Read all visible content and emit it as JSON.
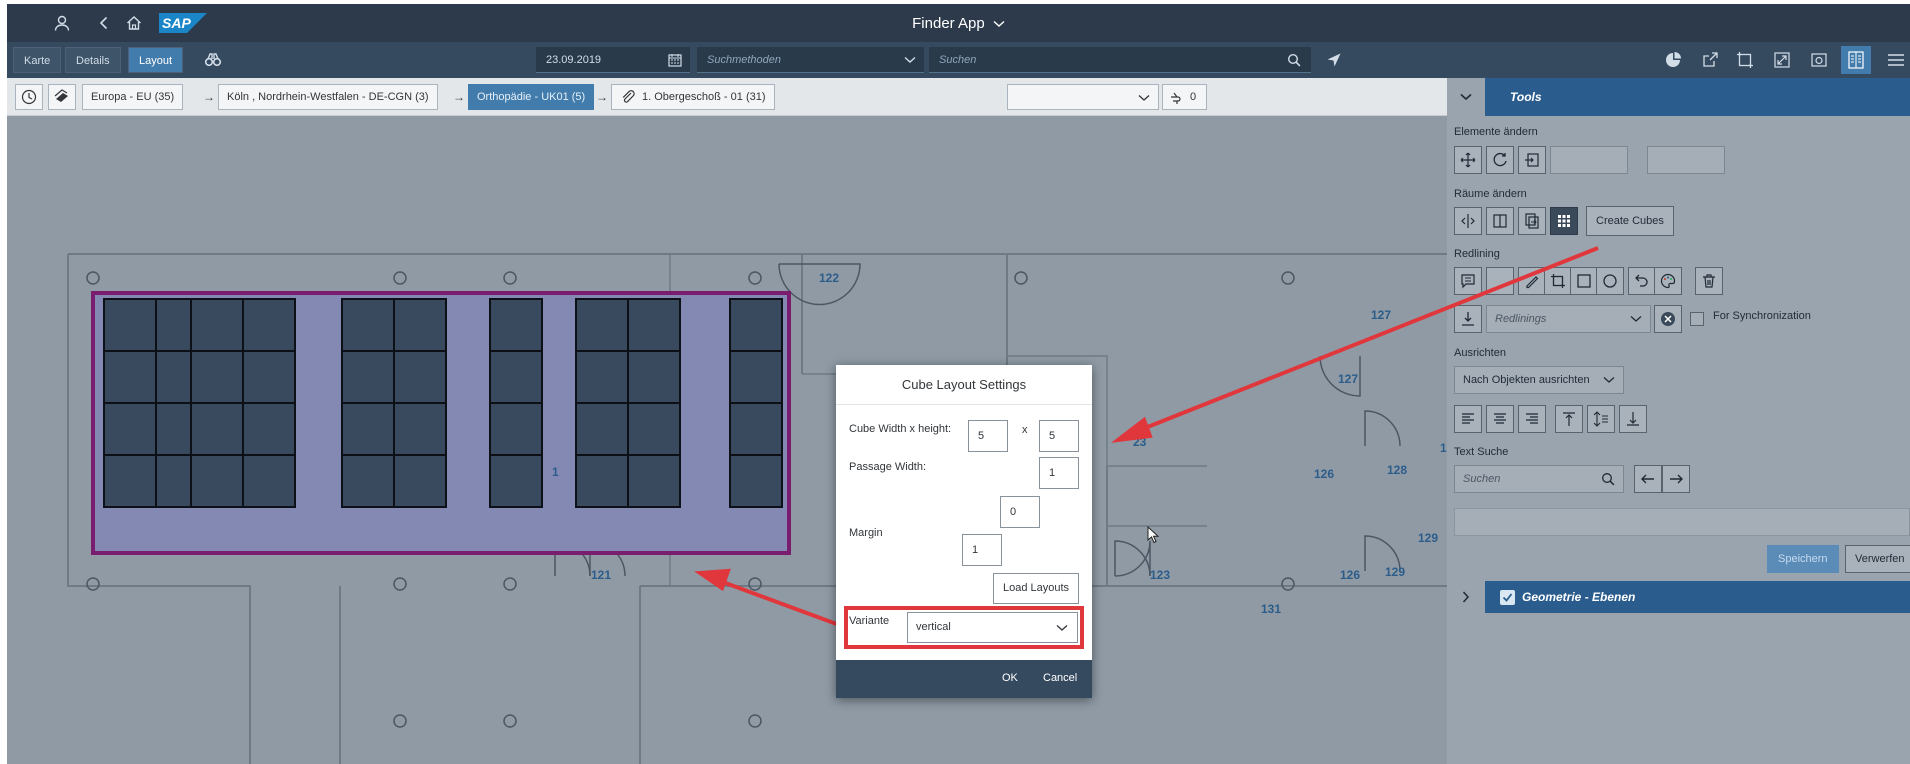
{
  "shell": {
    "app_title": "Finder App",
    "logo_text": "SAP",
    "icons": [
      "user-icon",
      "back-icon",
      "home-icon"
    ]
  },
  "toolbar": {
    "tabs": [
      {
        "label": "Karte",
        "active": false
      },
      {
        "label": "Details",
        "active": false
      },
      {
        "label": "Layout",
        "active": true
      }
    ],
    "date": "23.09.2019",
    "search_method_placeholder": "Suchmethoden",
    "search_placeholder": "Suchen",
    "right_icons": [
      "pie-chart-icon",
      "share-icon",
      "crop-icon",
      "expand-icon",
      "camera-icon",
      "panel-icon",
      "menu-icon"
    ]
  },
  "breadcrumb": {
    "items": [
      {
        "label": "Europa - EU (35)",
        "active": false
      },
      {
        "label": "Köln , Nordrhein-Westfalen - DE-CGN (3)",
        "active": false
      },
      {
        "label": "Orthopädie - UK01 (5)",
        "active": true
      },
      {
        "label": "1. Obergeschoß - 01 (31)",
        "active": false
      }
    ],
    "count": "0"
  },
  "floorplan": {
    "room_numbers": [
      "122",
      "127",
      "127",
      "126",
      "128",
      "129",
      "129",
      "121",
      "123",
      "126",
      "131",
      "1",
      "23",
      "1"
    ]
  },
  "tools": {
    "title": "Tools",
    "sections": {
      "elements": "Elemente ändern",
      "rooms": "Räume ändern",
      "redlining": "Redlining",
      "align": "Ausrichten",
      "text_search": "Text Suche"
    },
    "create_cubes_label": "Create Cubes",
    "redlinings_placeholder": "Redlinings",
    "sync_label": "For Synchronization",
    "align_select": "Nach Objekten ausrichten",
    "search_placeholder": "Suchen",
    "save_label": "Speichern",
    "discard_label": "Verwerfen",
    "geometry_label": "Geometrie - Ebenen"
  },
  "dialog": {
    "title": "Cube Layout Settings",
    "cube_label": "Cube Width x height:",
    "cube_width": "5",
    "cube_times": "x",
    "cube_height": "5",
    "passage_label": "Passage Width:",
    "passage_width": "1",
    "margin_label": "Margin",
    "margin_top": "0",
    "margin_left": "1",
    "load_layouts_label": "Load Layouts",
    "variant_label": "Variante",
    "variant_value": "vertical",
    "ok_label": "OK",
    "cancel_label": "Cancel"
  },
  "colors": {
    "shell": "#2c3a4b",
    "toolbar": "#354a5f",
    "accent": "#427cac",
    "annotation": "#e0373c",
    "cube_fill": "#3a4a5e",
    "cube_frame": "#7a1d6e"
  }
}
